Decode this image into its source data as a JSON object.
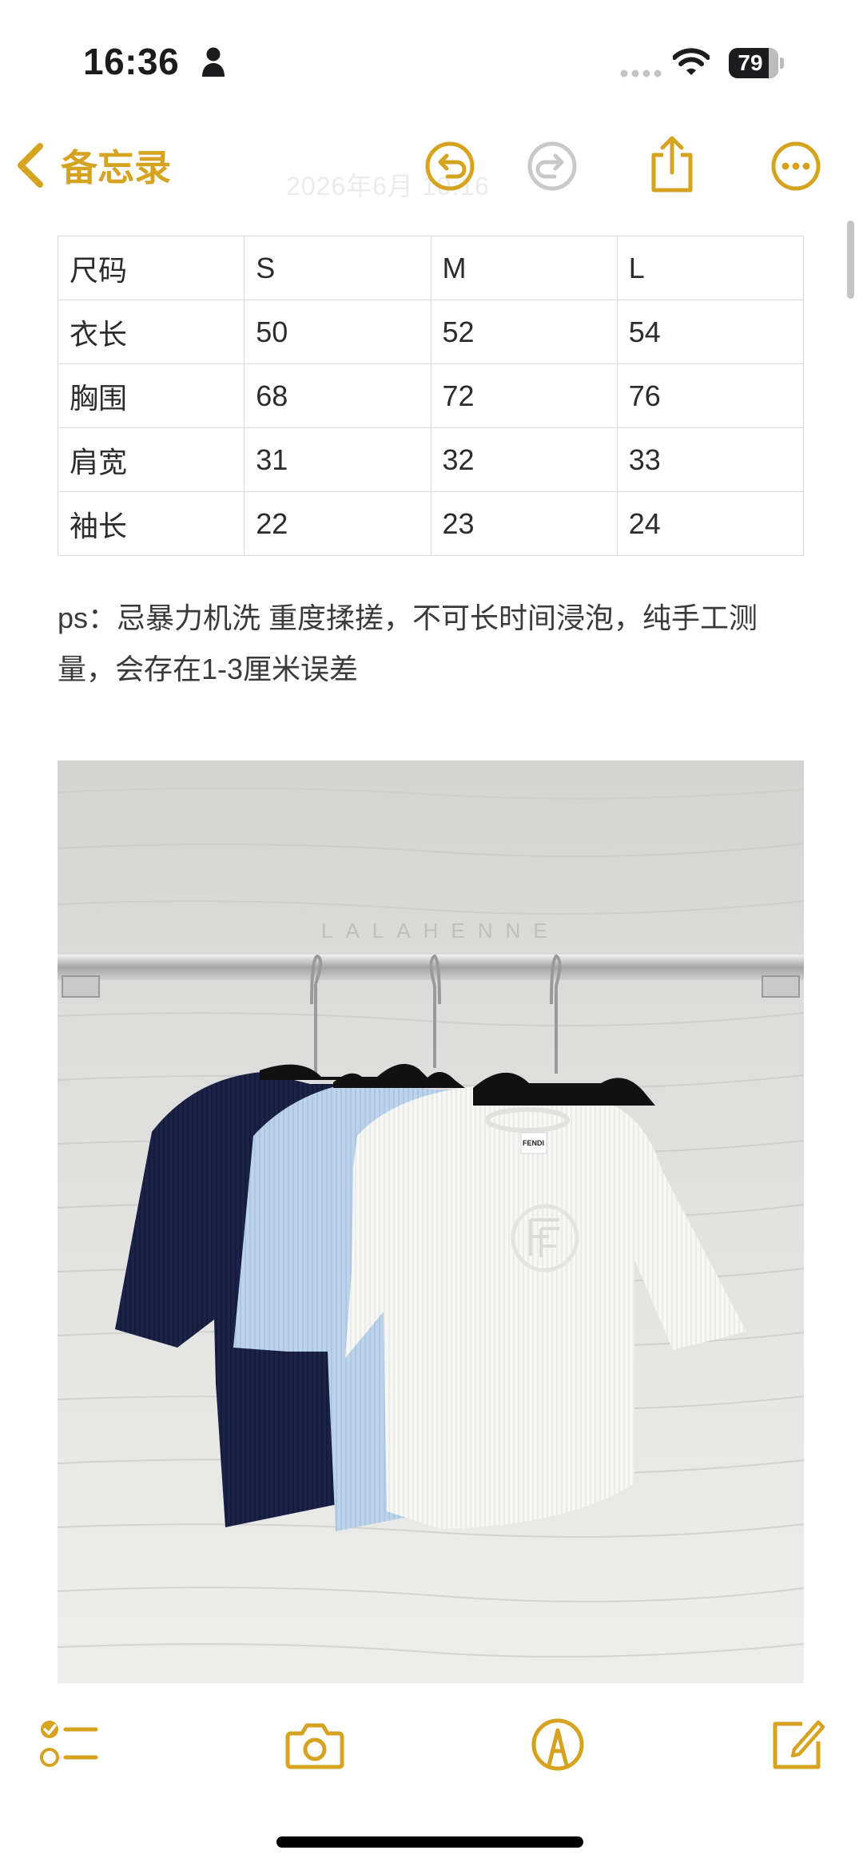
{
  "status_bar": {
    "time": "16:36",
    "battery": "79"
  },
  "nav": {
    "back_label": "备忘录",
    "faded_date": "2026年6月 10:16"
  },
  "size_table": {
    "header": [
      "尺码",
      "S",
      "M",
      "L"
    ],
    "rows": [
      [
        "衣长",
        "50",
        "52",
        "54"
      ],
      [
        "胸围",
        "68",
        "72",
        "76"
      ],
      [
        "肩宽",
        "31",
        "32",
        "33"
      ],
      [
        "袖长",
        "22",
        "23",
        "24"
      ]
    ]
  },
  "note": {
    "text": "ps：忌暴力机洗 重度揉搓，不可长时间浸泡，纯手工测量，会存在1-3厘米误差"
  },
  "photo": {
    "watermark": "LALAHENNE",
    "label_text": "FENDI"
  },
  "colors": {
    "accent": "#d6a320",
    "navy_shirt": "#1a2248",
    "blue_shirt": "#bcd3ec",
    "white_shirt": "#f6f6f4"
  },
  "icons": [
    "person-icon",
    "wifi-icon",
    "chevron-left-icon",
    "undo-icon",
    "redo-icon",
    "share-icon",
    "more-icon",
    "checklist-icon",
    "camera-icon",
    "markup-icon",
    "compose-icon"
  ]
}
